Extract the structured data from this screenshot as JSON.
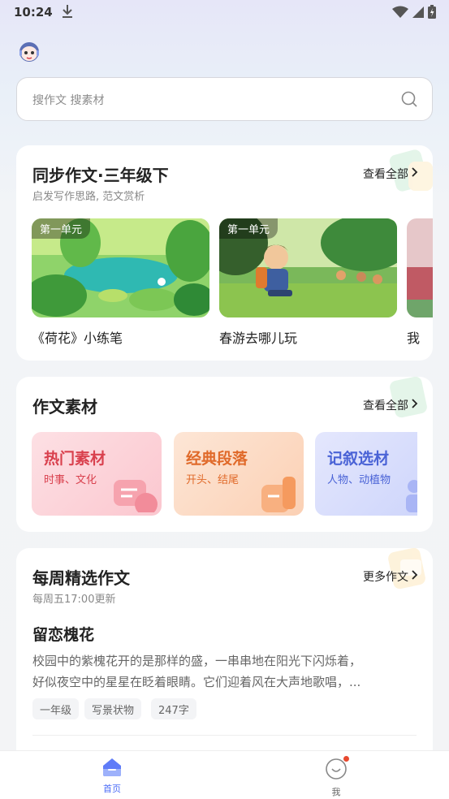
{
  "status": {
    "time": "10:24"
  },
  "search": {
    "placeholder": "搜作文 搜素材"
  },
  "sync_section": {
    "title": "同步作文·三年级下",
    "subtitle": "启发写作思路, 范文赏析",
    "view_all": "查看全部",
    "items": [
      {
        "tag": "第一单元",
        "caption": "《荷花》小练笔"
      },
      {
        "tag": "第一单元",
        "caption": "春游去哪儿玩"
      },
      {
        "tag": "",
        "caption": "我"
      }
    ]
  },
  "material_section": {
    "title": "作文素材",
    "view_all": "查看全部",
    "items": [
      {
        "title": "热门素材",
        "subtitle": "时事、文化",
        "color": "#d9414e"
      },
      {
        "title": "经典段落",
        "subtitle": "开头、结尾",
        "color": "#e06a2a"
      },
      {
        "title": "记叙选材",
        "subtitle": "人物、动植物",
        "color": "#4a63d6"
      }
    ]
  },
  "weekly_section": {
    "title": "每周精选作文",
    "subtitle": "每周五17:00更新",
    "more": "更多作文",
    "essay": {
      "title": "留恋槐花",
      "line1": "校园中的紫槐花开的是那样的盛，一串串地在阳光下闪烁着，",
      "line2": "好似夜空中的星星在眨着眼睛。它们迎着风在大声地歌唱，...",
      "tags": [
        "一年级",
        "写景状物",
        "247字"
      ]
    }
  },
  "tabbar": {
    "tabs": [
      {
        "label": "首页",
        "icon": "home-icon",
        "active": true
      },
      {
        "label": "我",
        "icon": "profile-icon",
        "active": false
      }
    ],
    "active_color": "#4b6cf7"
  }
}
